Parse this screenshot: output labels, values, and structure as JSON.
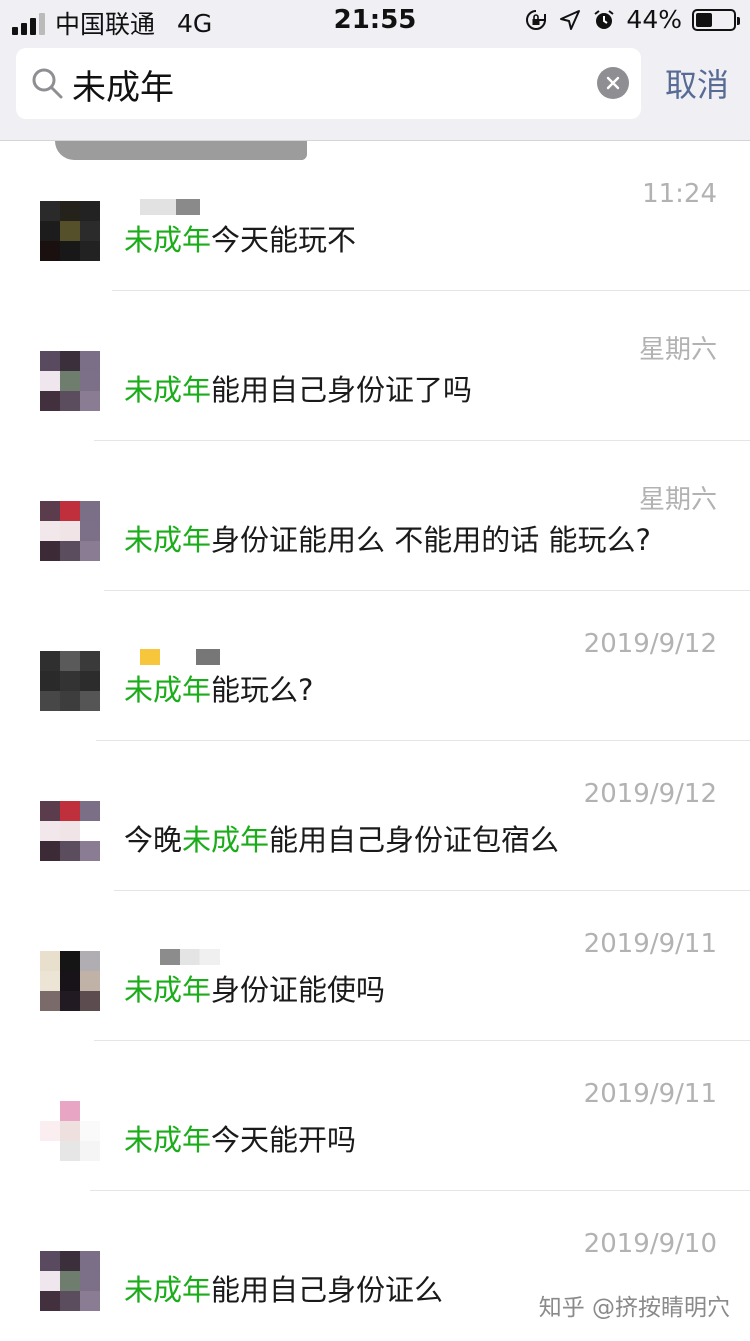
{
  "status_bar": {
    "carrier": "中国联通",
    "network": "4G",
    "time": "21:55",
    "battery_percent": "44%",
    "battery_level": 0.44,
    "icons": [
      "orientation-lock-icon",
      "location-icon",
      "alarm-icon"
    ]
  },
  "search": {
    "query": "未成年",
    "cancel_label": "取消"
  },
  "results": [
    {
      "time": "11:24",
      "before": "",
      "highlight": "未成年",
      "after": "今天能玩不"
    },
    {
      "time": "星期六",
      "before": "",
      "highlight": "未成年",
      "after": "能用自己身份证了吗"
    },
    {
      "time": "星期六",
      "before": "",
      "highlight": "未成年",
      "after": "身份证能用么 不能用的话 能玩么?"
    },
    {
      "time": "2019/9/12",
      "before": "",
      "highlight": "未成年",
      "after": "能玩么?"
    },
    {
      "time": "2019/9/12",
      "before": "今晚",
      "highlight": "未成年",
      "after": "能用自己身份证包宿么"
    },
    {
      "time": "2019/9/11",
      "before": "",
      "highlight": "未成年",
      "after": "身份证能使吗"
    },
    {
      "time": "2019/9/11",
      "before": "",
      "highlight": "未成年",
      "after": "今天能开吗"
    },
    {
      "time": "2019/9/10",
      "before": "",
      "highlight": "未成年",
      "after": "能用自己身份证么"
    }
  ],
  "watermark": "知乎 @挤按睛明穴",
  "colors": {
    "highlight": "#1aad19",
    "cancel": "#576b95",
    "timestamp": "#b2b2b2",
    "header_bg": "#efeff4"
  }
}
